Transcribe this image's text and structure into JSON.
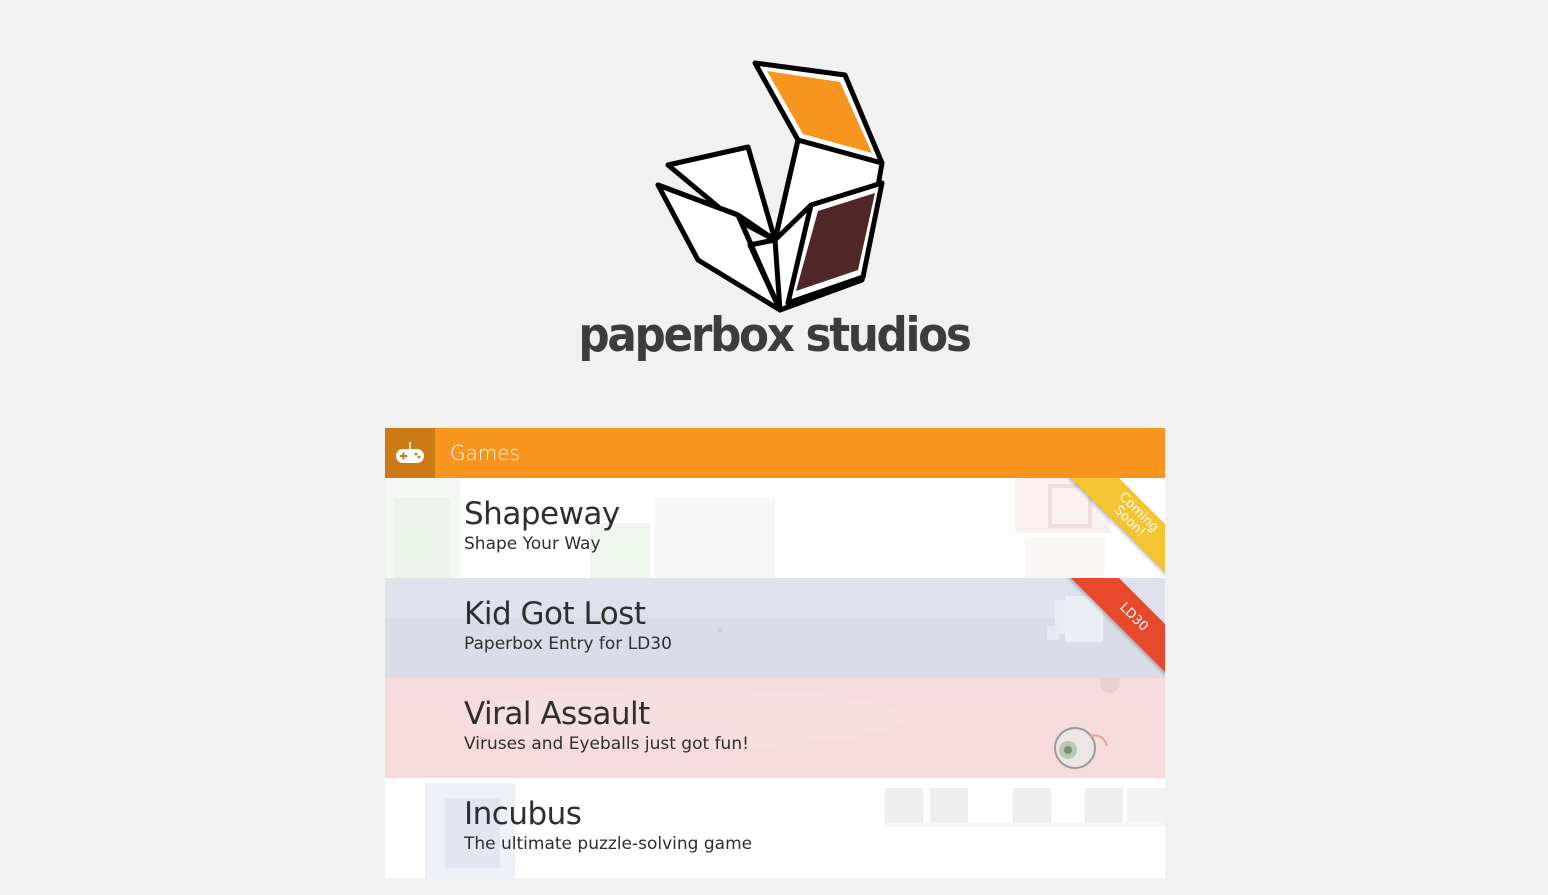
{
  "brand": {
    "name": "paperbox studios",
    "colors": {
      "orange": "#f7951f",
      "brown": "#512626",
      "outline": "#000000"
    }
  },
  "games_panel": {
    "icon": "gamepad-icon",
    "title": "Games",
    "items": [
      {
        "title": "Shapeway",
        "subtitle": "Shape Your Way",
        "ribbon": "Coming Soon!",
        "ribbon_color": "#f5c433",
        "background": "#ffffff"
      },
      {
        "title": "Kid Got Lost",
        "subtitle": "Paperbox Entry for LD30",
        "ribbon": "LD30",
        "ribbon_color": "#e8492c",
        "background": "#d9dbe8"
      },
      {
        "title": "Viral Assault",
        "subtitle": "Viruses and Eyeballs just got fun!",
        "background": "#f4d9da"
      },
      {
        "title": "Incubus",
        "subtitle": "The ultimate puzzle-solving game",
        "background": "#ffffff"
      }
    ]
  }
}
